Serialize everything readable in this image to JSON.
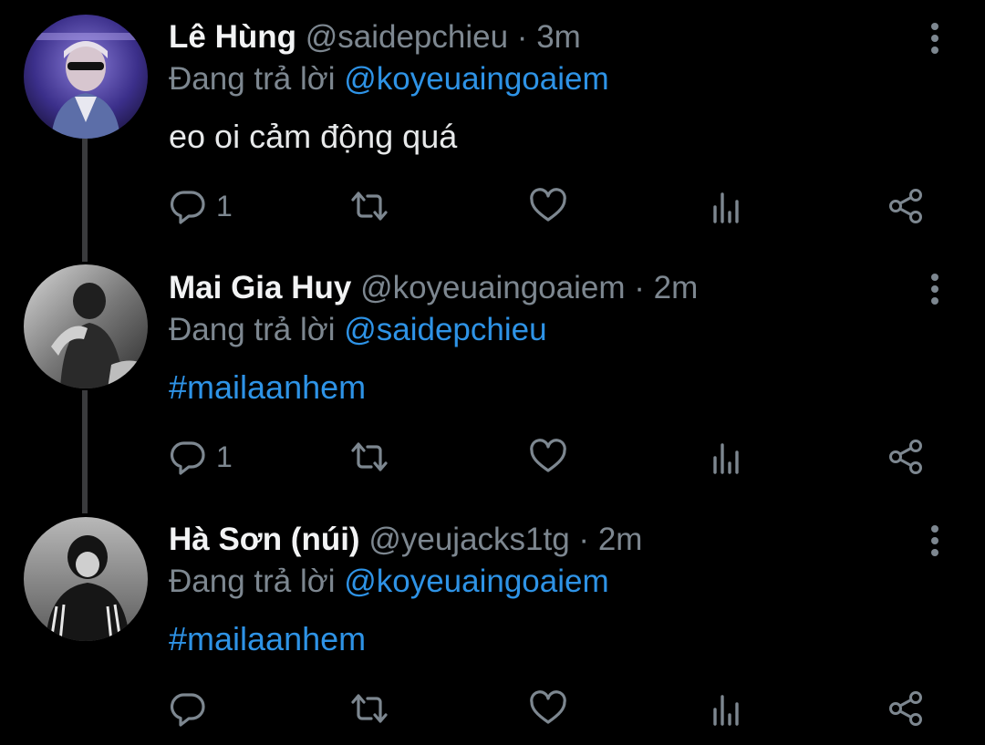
{
  "tweets": [
    {
      "name": "Lê Hùng",
      "handle": "@saidepchieu",
      "separator": "·",
      "time": "3m",
      "reply_prefix": "Đang trả lời",
      "reply_to": "@koyeuaingoaiem",
      "text": "eo oi cảm động quá",
      "reply_count": "1",
      "avatar_desc": "avatar-purple"
    },
    {
      "name": "Mai Gia Huy",
      "handle": "@koyeuaingoaiem",
      "separator": "·",
      "time": "2m",
      "reply_prefix": "Đang trả lời",
      "reply_to": "@saidepchieu",
      "text": "#mailaanhem",
      "reply_count": "1",
      "avatar_desc": "avatar-gray"
    },
    {
      "name": "Hà Sơn (núi)",
      "handle": "@yeujacks1tg",
      "separator": "·",
      "time": "2m",
      "reply_prefix": "Đang trả lời",
      "reply_to": "@koyeuaingoaiem",
      "text": "#mailaanhem",
      "reply_count": "",
      "avatar_desc": "avatar-dark"
    }
  ],
  "colors": {
    "background": "#000000",
    "link": "#2e93e6",
    "muted": "#7d8790",
    "text": "#e7e9ea"
  },
  "icons": [
    "reply-icon",
    "retweet-icon",
    "like-icon",
    "analytics-icon",
    "share-icon",
    "more-options-icon"
  ]
}
